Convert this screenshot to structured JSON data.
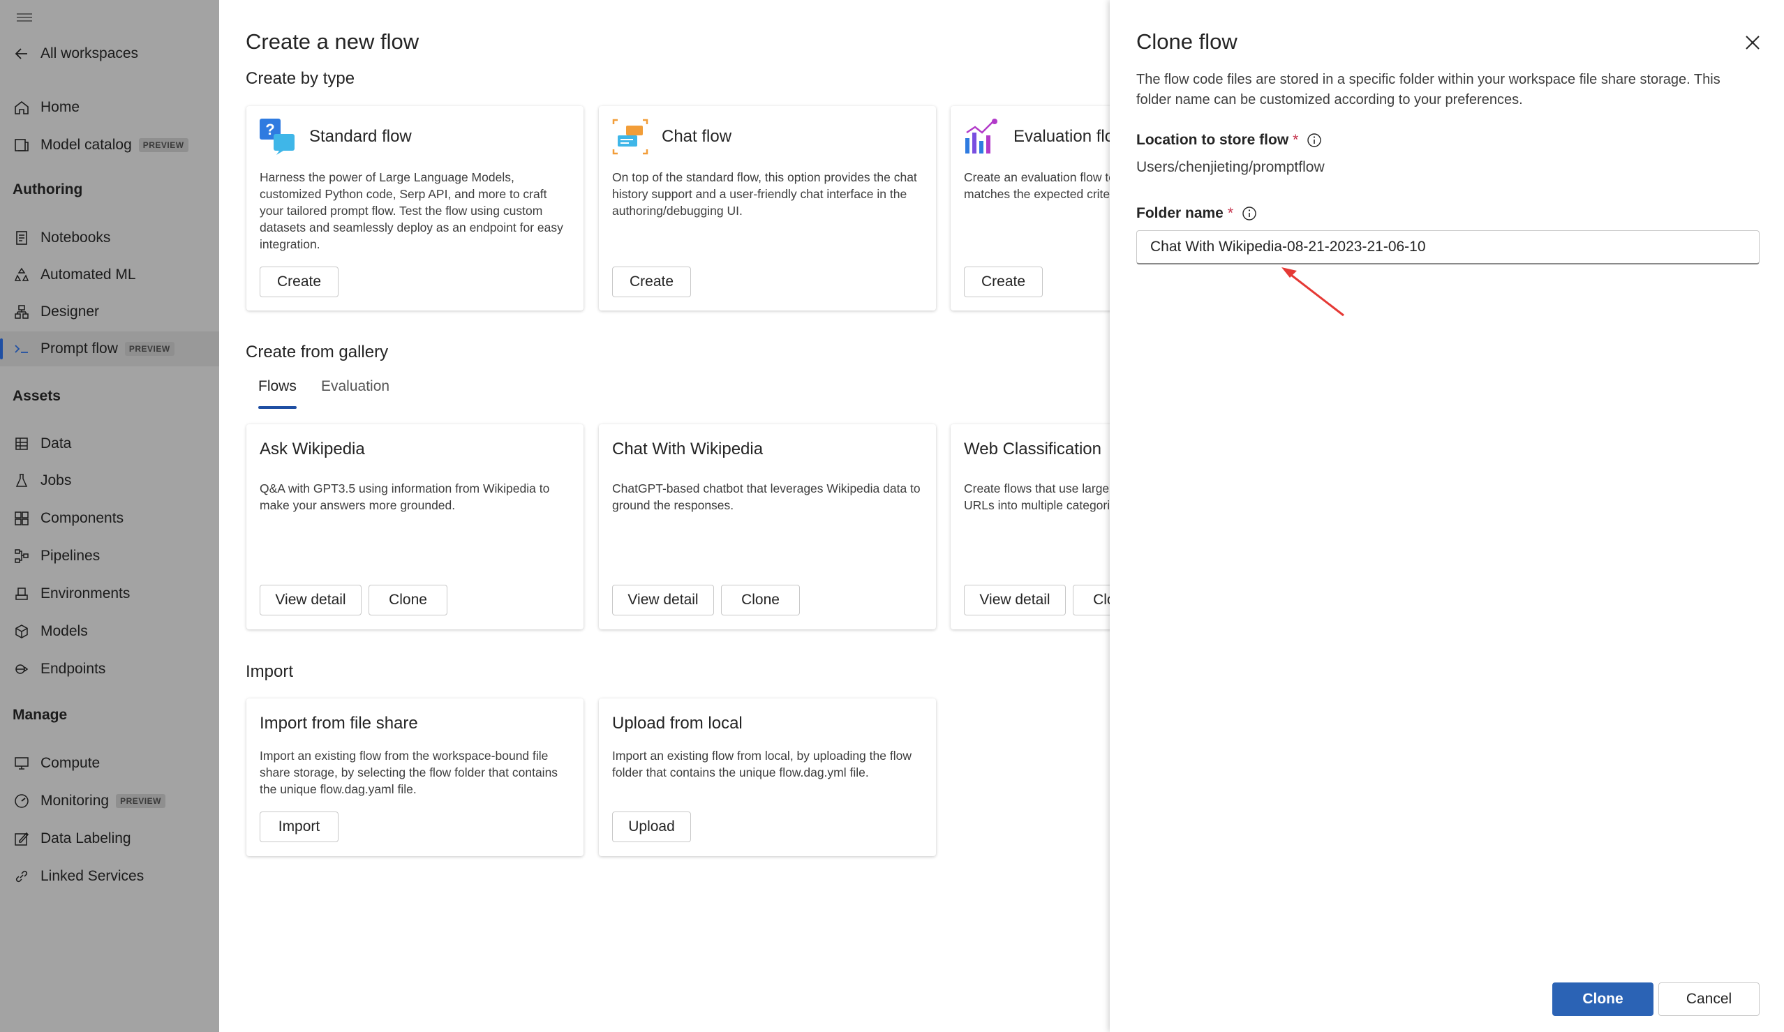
{
  "sidebar": {
    "back_label": "All workspaces",
    "items_top": [
      {
        "label": "Home",
        "icon": "home-icon"
      },
      {
        "label": "Model catalog",
        "icon": "catalog-icon",
        "badge": "PREVIEW"
      }
    ],
    "sections": [
      {
        "title": "Authoring",
        "items": [
          {
            "label": "Notebooks",
            "icon": "notebook-icon"
          },
          {
            "label": "Automated ML",
            "icon": "automl-icon"
          },
          {
            "label": "Designer",
            "icon": "designer-icon"
          },
          {
            "label": "Prompt flow",
            "icon": "prompt-flow-icon",
            "badge": "PREVIEW",
            "active": true
          }
        ]
      },
      {
        "title": "Assets",
        "items": [
          {
            "label": "Data",
            "icon": "data-icon"
          },
          {
            "label": "Jobs",
            "icon": "jobs-icon"
          },
          {
            "label": "Components",
            "icon": "components-icon"
          },
          {
            "label": "Pipelines",
            "icon": "pipelines-icon"
          },
          {
            "label": "Environments",
            "icon": "environments-icon"
          },
          {
            "label": "Models",
            "icon": "models-icon"
          },
          {
            "label": "Endpoints",
            "icon": "endpoints-icon"
          }
        ]
      },
      {
        "title": "Manage",
        "items": [
          {
            "label": "Compute",
            "icon": "compute-icon"
          },
          {
            "label": "Monitoring",
            "icon": "monitoring-icon",
            "badge": "PREVIEW"
          },
          {
            "label": "Data Labeling",
            "icon": "labeling-icon"
          },
          {
            "label": "Linked Services",
            "icon": "linked-services-icon"
          }
        ]
      }
    ]
  },
  "main": {
    "title": "Create a new flow",
    "by_type": {
      "heading": "Create by type",
      "cards": [
        {
          "title": "Standard flow",
          "desc": "Harness the power of Large Language Models, customized Python code, Serp API, and more to craft your tailored prompt flow. Test the flow using custom datasets and seamlessly deploy as an endpoint for easy integration.",
          "button": "Create"
        },
        {
          "title": "Chat flow",
          "desc": "On top of the standard flow, this option provides the chat history support and a user-friendly chat interface in the authoring/debugging UI.",
          "button": "Create"
        },
        {
          "title": "Evaluation flow",
          "desc": "Create an evaluation flow to measure how well the output matches the expected criteria and goals.",
          "button": "Create"
        }
      ]
    },
    "gallery": {
      "heading": "Create from gallery",
      "tabs": [
        "Flows",
        "Evaluation"
      ],
      "cards": [
        {
          "title": "Ask Wikipedia",
          "desc": "Q&A with GPT3.5 using information from Wikipedia to make your answers more grounded.",
          "view": "View detail",
          "clone": "Clone"
        },
        {
          "title": "Chat With Wikipedia",
          "desc": "ChatGPT-based chatbot that leverages Wikipedia data to ground the responses.",
          "view": "View detail",
          "clone": "Clone"
        },
        {
          "title": "Web Classification",
          "desc": "Create flows that use large language models to classify URLs into multiple categories.",
          "view": "View detail",
          "clone": "Clone"
        }
      ]
    },
    "import": {
      "heading": "Import",
      "cards": [
        {
          "title": "Import from file share",
          "desc": "Import an existing flow from the workspace-bound file share storage, by selecting the flow folder that contains the unique flow.dag.yaml file.",
          "button": "Import"
        },
        {
          "title": "Upload from local",
          "desc": "Import an existing flow from local, by uploading the flow folder that contains the unique flow.dag.yml file.",
          "button": "Upload"
        }
      ]
    }
  },
  "panel": {
    "title": "Clone flow",
    "description": "The flow code files are stored in a specific folder within your workspace file share storage. This folder name can be customized according to your preferences.",
    "location_label": "Location to store flow",
    "location_value": "Users/chenjieting/promptflow",
    "folder_label": "Folder name",
    "required_mark": "*",
    "folder_value": "Chat With Wikipedia-08-21-2023-21-06-10",
    "clone_button": "Clone",
    "cancel_button": "Cancel"
  },
  "colors": {
    "accent": "#2b63b5",
    "sidebar_bg": "#a3a3a3",
    "annotation_arrow": "#e53935"
  }
}
